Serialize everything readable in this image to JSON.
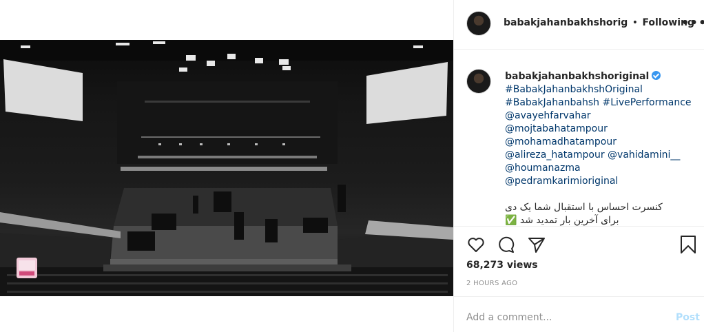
{
  "post": {
    "username": "babakjahanbakhshorig",
    "dot": "•",
    "follow_label": "Following",
    "more_label": "•••"
  },
  "caption": {
    "username": "babakjahanbakhshoriginal",
    "lines": [
      "#BabakJahanbakhshOriginal",
      "#BabakJahanbahsh #LivePerformance",
      "@avayehfarvahar",
      "@mojtabahatampour",
      "@mohamadhatampour"
    ],
    "line_mixed_1": "@alireza_hatampour",
    "line_mixed_2": "@vahidamini__",
    "lines_after": [
      "@houmanazma",
      "@pedramkarimioriginal"
    ],
    "persian_line_1": "کنسرت احساس با استقبال شما یک دی",
    "persian_line_2": "برای آخرین بار تمدید شد ✅"
  },
  "actions": {
    "like_icon": "heart-icon",
    "comment_icon": "comment-icon",
    "share_icon": "send-icon",
    "save_icon": "bookmark-icon",
    "views": "68,273 views",
    "time": "2 HOURS AGO"
  },
  "comment": {
    "placeholder": "Add a comment...",
    "post_label": "Post"
  },
  "video": {
    "sound_icon": "speaker-icon"
  },
  "colors": {
    "link": "#00376b",
    "verified": "#3897f0",
    "post_disabled": "#b2dffc"
  }
}
